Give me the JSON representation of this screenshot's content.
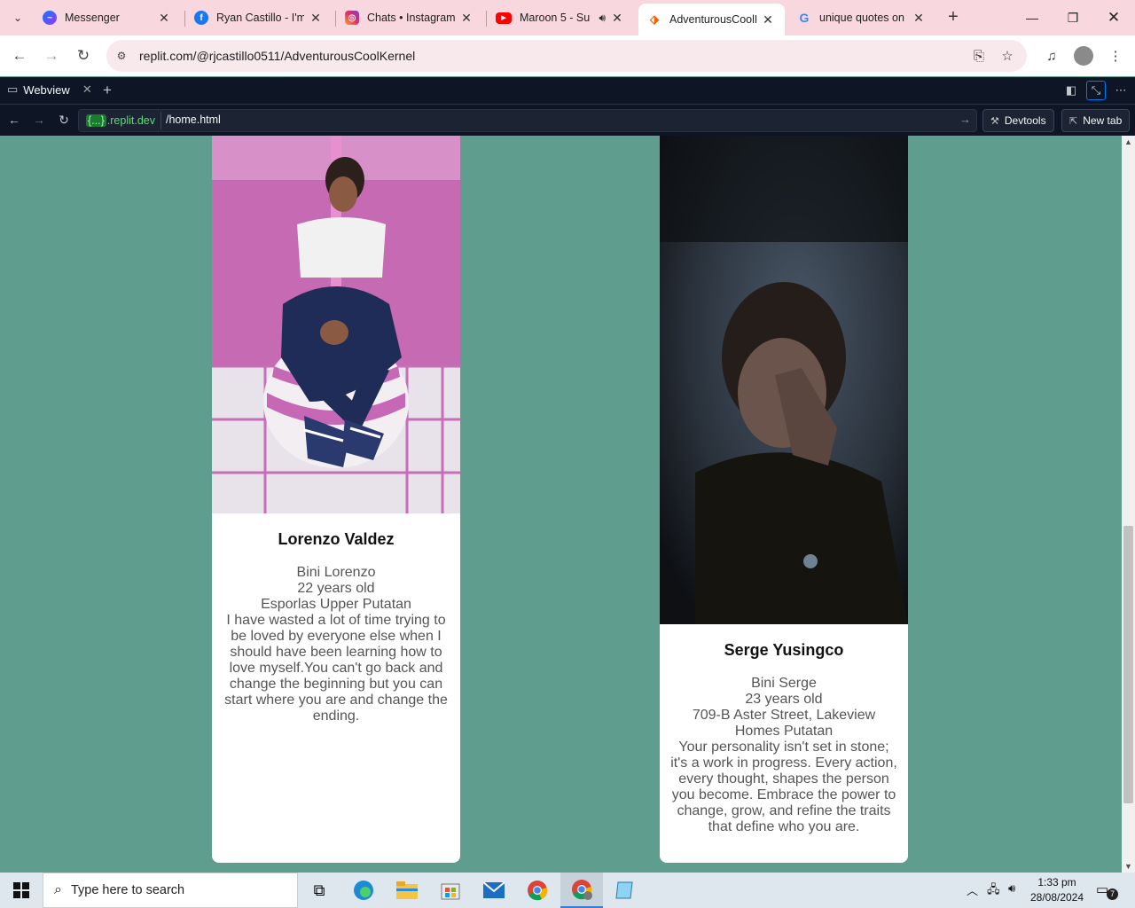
{
  "browser": {
    "tabs": [
      {
        "title": "Messenger",
        "icon": "messenger-icon"
      },
      {
        "title": "Ryan Castillo - I'm",
        "icon": "facebook-icon"
      },
      {
        "title": "Chats • Instagram",
        "icon": "instagram-icon"
      },
      {
        "title": "Maroon 5 - Su",
        "icon": "youtube-icon"
      },
      {
        "title": "AdventurousCoolK",
        "icon": "replit-icon",
        "active": true
      },
      {
        "title": "unique quotes on",
        "icon": "google-icon"
      }
    ],
    "url": "replit.com/@rjcastillo0511/AdventurousCoolKernel"
  },
  "replit": {
    "tab_label": "Webview",
    "domain_brace": "{...}",
    "domain_suffix": ".replit.dev",
    "path": "/home.html",
    "devtools_label": "Devtools",
    "newtab_label": "New tab"
  },
  "cards": [
    {
      "name": "Lorenzo Valdez",
      "nickname": "Bini Lorenzo",
      "age": "22 years old",
      "address": "Esporlas Upper Putatan",
      "quote": "I have wasted a lot of time trying to be loved by everyone else when I should have been learning how to love myself.You can't go back and change the beginning but you can start where you are and change the ending."
    },
    {
      "name": "Serge Yusingco",
      "nickname": "Bini Serge",
      "age": "23 years old",
      "address": "709-B Aster Street, Lakeview Homes Putatan",
      "quote": "Your personality isn't set in stone; it's a work in progress. Every action, every thought, shapes the person you become. Embrace the power to change, grow, and refine the traits that define who you are."
    }
  ],
  "taskbar": {
    "search_placeholder": "Type here to search",
    "time": "1:33 pm",
    "date": "28/08/2024",
    "notifications": "7"
  },
  "colors": {
    "page_bg": "#5f9e8f",
    "tabstrip_bg": "#f8d7df",
    "replit_header": "#0e1525"
  }
}
